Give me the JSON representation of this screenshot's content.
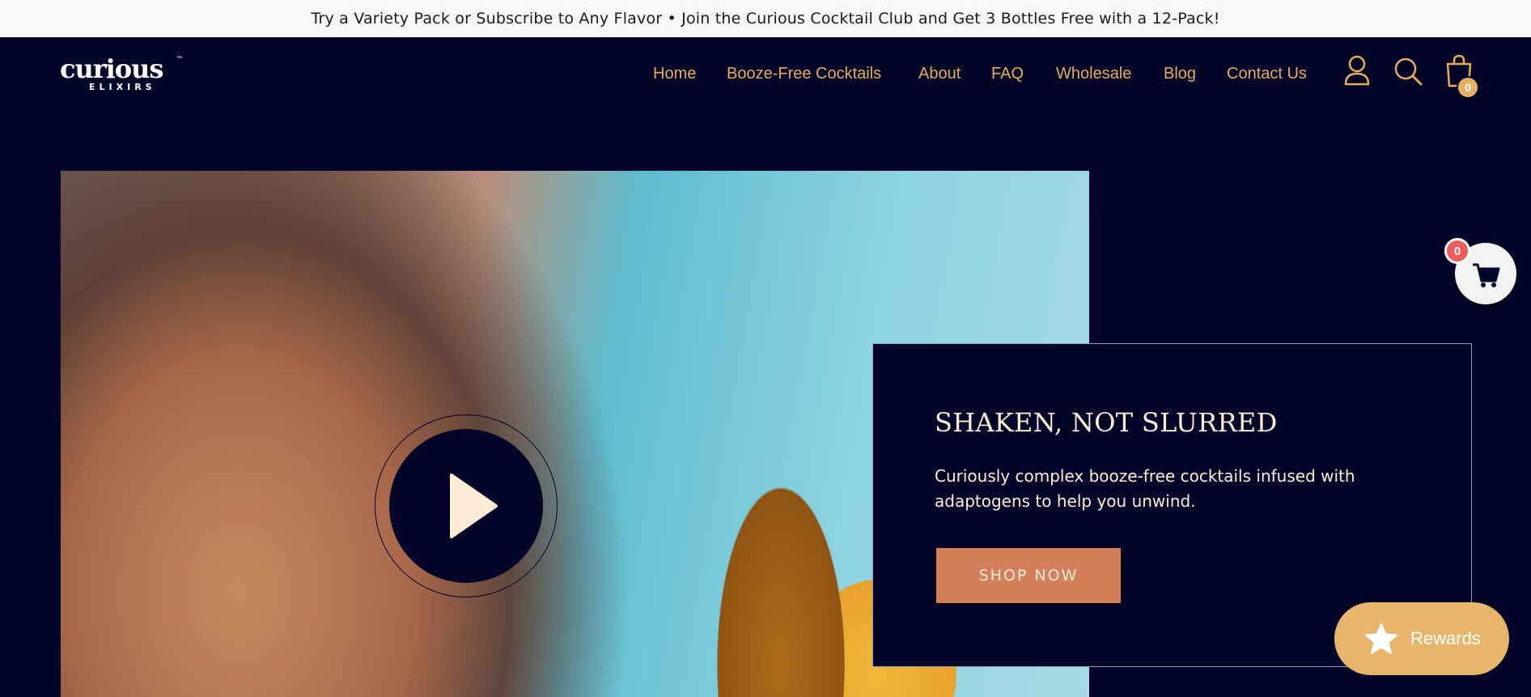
{
  "announcement": "Try a Variety Pack or Subscribe to Any Flavor • Join the Curious Cocktail Club and Get 3 Bottles Free with a 12-Pack!",
  "brand": {
    "name": "curious",
    "tagline": "ELIXIRS",
    "trademark": "™"
  },
  "nav": {
    "items": [
      "Home",
      "Booze-Free Cocktails",
      "About",
      "FAQ",
      "Wholesale",
      "Blog",
      "Contact Us"
    ]
  },
  "header_icons": [
    "account-icon",
    "search-icon",
    "cart-icon"
  ],
  "cart_count": "0",
  "hero": {
    "title": "SHAKEN, NOT SLURRED",
    "body": "Curiously complex booze-free cocktails infused with adaptogens to help you unwind.",
    "cta": "SHOP NOW"
  },
  "floating_cart_count": "0",
  "rewards_label": "Rewards",
  "colors": {
    "background": "#05052a",
    "nav_accent": "#e4ad5d",
    "cta": "#d4815b",
    "text_light": "#fdecd6",
    "rewards": "#e8b56c",
    "badge_red": "#ef5b5b"
  }
}
